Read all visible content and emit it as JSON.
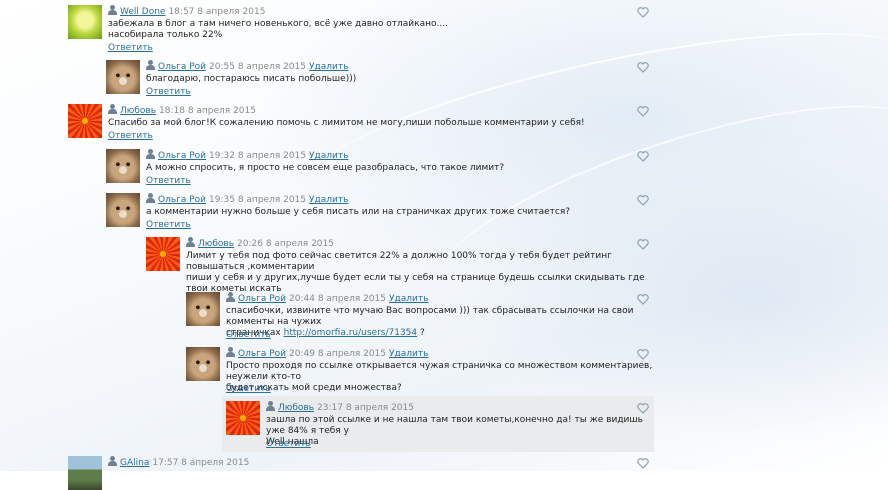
{
  "comments": [
    {
      "user": "Well Done",
      "date": "18:57 8 апреля 2015",
      "delete": "",
      "lines": [
        "забежала в блог а там ничего новенького, всё уже давно отлайкано....",
        "насобирала только 22%"
      ],
      "reply": "Ответить",
      "avatar": "green-avatar"
    },
    {
      "user": "Ольга Рой",
      "date": "20:55 8 апреля 2015",
      "delete": "Удалить",
      "lines": [
        "благодарю, постараюсь писать побольше)))"
      ],
      "reply": "Ответить",
      "avatar": "cat-avatar"
    },
    {
      "user": "Любовь",
      "date": "18:18 8 апреля 2015",
      "delete": "",
      "lines": [
        "Спасибо за мой блог!К сожалению помочь с лимитом не могу,пиши побольше комментарии у себя!"
      ],
      "reply": "Ответить",
      "avatar": "flower-avatar"
    },
    {
      "user": "Ольга Рой",
      "date": "19:32 8 апреля 2015",
      "delete": "Удалить",
      "lines": [
        "А можно спросить, я просто не совсем еще разобралась, что такое лимит?"
      ],
      "reply": "Ответить",
      "avatar": "cat-avatar"
    },
    {
      "user": "Ольга Рой",
      "date": "19:35 8 апреля 2015",
      "delete": "Удалить",
      "lines": [
        "а комментарии нужно больше у себя писать или на страничках других тоже считается?"
      ],
      "reply": "Ответить",
      "avatar": "cat-avatar"
    },
    {
      "user": "Любовь",
      "date": "20:26 8 апреля 2015",
      "delete": "",
      "lines": [
        "Лимит у тебя под фото сейчас светится 22% а должно 100% тогда у тебя будет рейтинг повышаться ,комментарии",
        "пиши у себя и у других,лучше будет если ты у себя на странице будешь ссылки скидывать где твои кометы искать"
      ],
      "reply": "Ответить",
      "avatar": "flower-avatar"
    },
    {
      "user": "Ольга Рой",
      "date": "20:44 8 апреля 2015",
      "delete": "Удалить",
      "lines": [
        "спасибочки, извините что мучаю Вас вопросами ))) так сбрасывать ссылочки на свои комменты на чужих"
      ],
      "line2_prefix": "страничках ",
      "link": "http://omorfia.ru/users/71354",
      "line2_suffix": " ?",
      "reply": "Ответить",
      "avatar": "cat-avatar"
    },
    {
      "user": "Ольга Рой",
      "date": "20:49 8 апреля 2015",
      "delete": "Удалить",
      "lines": [
        "Просто проходя по ссылке открывается чужая страничка со множеством комментариев, неужели кто-то",
        "будет искать мой среди множества?"
      ],
      "reply": "Ответить",
      "avatar": "cat-avatar"
    },
    {
      "user": "Любовь",
      "date": "23:17 8 апреля 2015",
      "delete": "",
      "lines": [
        "зашла по этой ссылке и не нашла там твои кометы,конечно да! ты же видишь уже 84% я тебя у",
        "Well нашла"
      ],
      "reply": "Ответить",
      "avatar": "flower-avatar"
    },
    {
      "user": "GAlina",
      "date": "17:57 8 апреля 2015",
      "delete": "",
      "lines": [],
      "reply": "",
      "avatar": "photo-avatar"
    }
  ],
  "colors": {
    "link": "#2a6f96",
    "date": "#8a8a8a",
    "highlight": "#e9ebed",
    "heart": "#8fa3b3"
  }
}
